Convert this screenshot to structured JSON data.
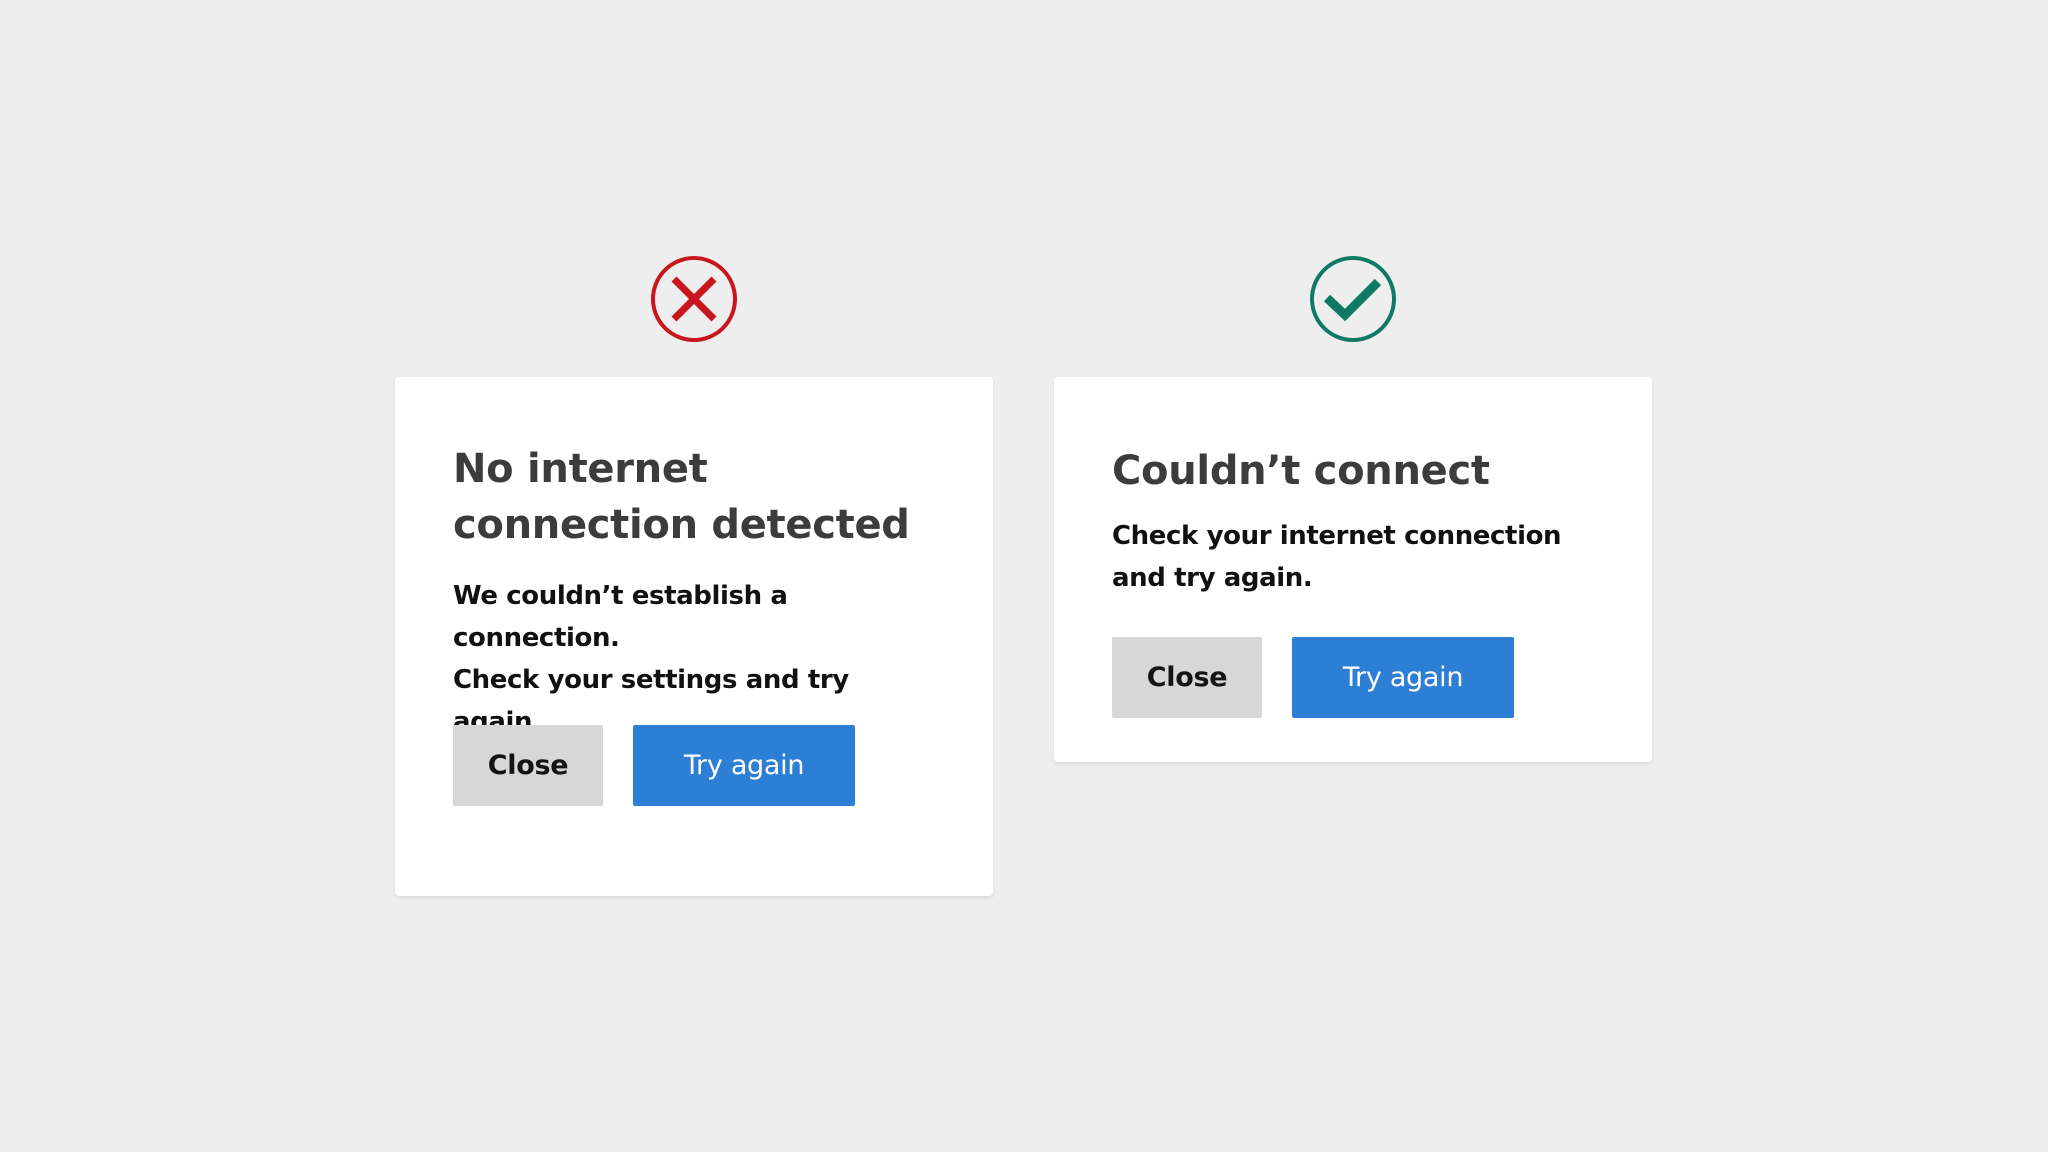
{
  "colors": {
    "page_background": "#eeeeee",
    "error_icon": "#c8161d",
    "success_icon": "#0f7a63",
    "primary_button": "#2d7fd5",
    "secondary_button": "#d7d7d7"
  },
  "dialogs": [
    {
      "status_icon": "error-cross-icon",
      "title_lines": [
        "No internet",
        "connection detected"
      ],
      "body_lines": [
        "We couldn’t establish a connection.",
        "Check your settings and try again."
      ],
      "close_label": "Close",
      "retry_label": "Try again"
    },
    {
      "status_icon": "success-check-icon",
      "title_lines": [
        "Couldn’t connect"
      ],
      "body_lines": [
        "Check your internet connection",
        "and try again."
      ],
      "close_label": "Close",
      "retry_label": "Try again"
    }
  ]
}
